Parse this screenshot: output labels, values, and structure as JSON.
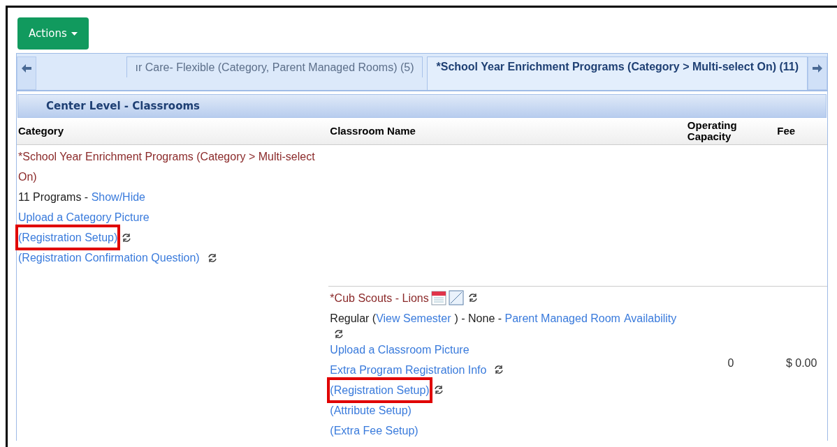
{
  "actions_button": {
    "label": "Actions"
  },
  "tabs": [
    {
      "label": "ır Care- Flexible (Category, Parent Managed Rooms) (5)",
      "selected": false
    },
    {
      "label": "*School Year Enrichment Programs (Category > Multi-select On) (11)",
      "selected": true
    }
  ],
  "section_title": "Center Level - Classrooms",
  "table": {
    "columns": [
      "Category",
      "Classroom Name",
      "Operating Capacity",
      "Fee"
    ],
    "category": {
      "lines": [
        {
          "parts": [
            {
              "kind": "title",
              "text": "*School Year Enrichment Programs (Category > Multi-select On)"
            }
          ],
          "sync": false,
          "highlighted": false
        },
        {
          "parts": [
            {
              "kind": "text",
              "text": "11 Programs - "
            },
            {
              "kind": "link",
              "text": "Show/Hide"
            }
          ],
          "sync": false,
          "highlighted": false
        },
        {
          "parts": [
            {
              "kind": "link",
              "text": "Upload a Category Picture"
            }
          ],
          "sync": false,
          "highlighted": false
        },
        {
          "parts": [
            {
              "kind": "link",
              "text": "(Registration Setup)"
            }
          ],
          "sync": true,
          "highlighted": true
        },
        {
          "parts": [
            {
              "kind": "link",
              "text": "(Registration Confirmation Question)"
            }
          ],
          "sync": true,
          "highlighted": false
        }
      ]
    },
    "classroom": {
      "lines": [
        {
          "parts": [
            {
              "kind": "title",
              "text": "*Cub Scouts - Lions"
            }
          ],
          "kind": "titled",
          "sync": true,
          "highlighted": false
        },
        {
          "parts": [
            {
              "kind": "text",
              "text": "Regular ("
            },
            {
              "kind": "link",
              "text": "View Semester"
            },
            {
              "kind": "text",
              "text": ") - None - "
            },
            {
              "kind": "link",
              "text": "Parent Managed Room"
            },
            {
              "kind": "link",
              "text": "Availability"
            }
          ],
          "sync": true,
          "highlighted": false
        },
        {
          "parts": [
            {
              "kind": "link",
              "text": "Upload a Classroom Picture"
            }
          ],
          "sync": false,
          "highlighted": false
        },
        {
          "parts": [
            {
              "kind": "link",
              "text": "Extra Program Registration Info"
            }
          ],
          "sync": true,
          "highlighted": false
        },
        {
          "parts": [
            {
              "kind": "link",
              "text": "(Registration Setup)"
            }
          ],
          "sync": true,
          "highlighted": true
        },
        {
          "parts": [
            {
              "kind": "link",
              "text": "(Attribute Setup)"
            }
          ],
          "sync": false,
          "highlighted": false
        },
        {
          "parts": [
            {
              "kind": "link",
              "text": "(Extra Fee Setup)"
            }
          ],
          "sync": false,
          "highlighted": false
        }
      ],
      "capacity": "0",
      "fee": "$ 0.00"
    }
  }
}
